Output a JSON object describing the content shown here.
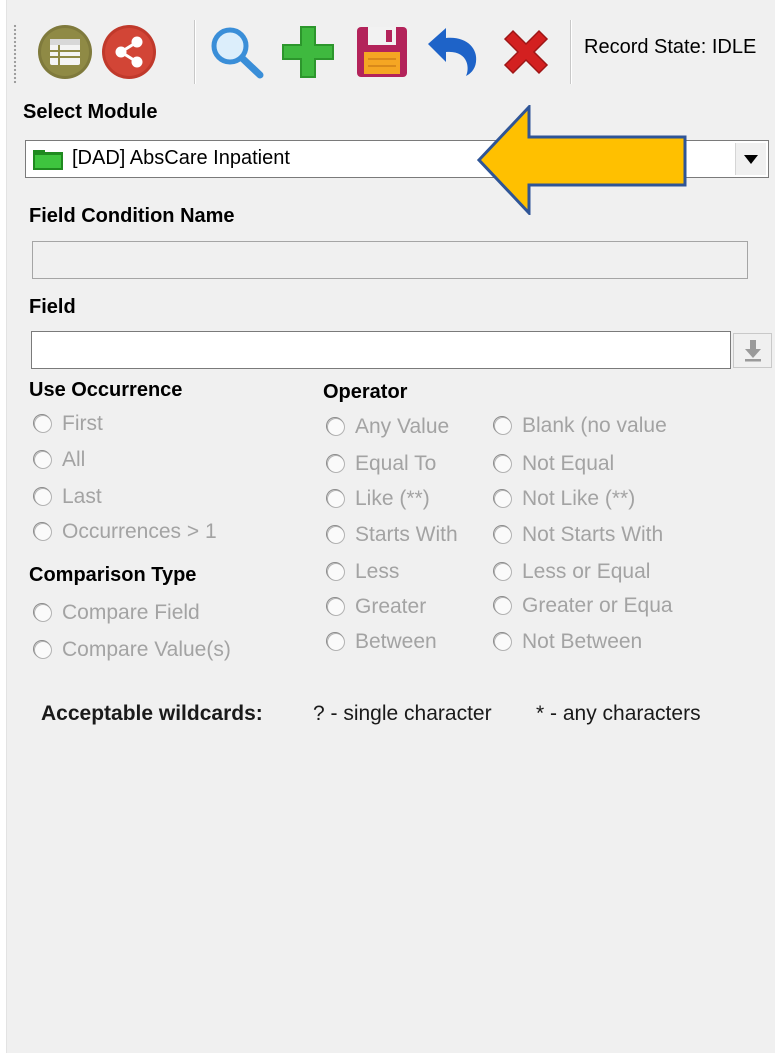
{
  "toolbar": {
    "buttons": [
      {
        "icon": "list-icon",
        "color": "#7d7a3e"
      },
      {
        "icon": "share-icon",
        "color": "#c0392b"
      },
      {
        "icon": "search-icon",
        "color": "#3a8ed8"
      },
      {
        "icon": "add-icon",
        "color": "#3bb63b"
      },
      {
        "icon": "save-icon",
        "color": "#b0225a"
      },
      {
        "icon": "undo-icon",
        "color": "#1e63c8"
      },
      {
        "icon": "delete-icon",
        "color": "#d32020"
      }
    ],
    "record_state": "Record State: IDLE"
  },
  "select_module": {
    "label": "Select Module",
    "value": "[DAD] AbsCare Inpatient"
  },
  "field_condition_name": {
    "label": "Field Condition Name",
    "value": ""
  },
  "field": {
    "label": "Field",
    "value": ""
  },
  "use_occurrence": {
    "label": "Use Occurrence",
    "options": [
      "First",
      "All",
      "Last",
      "Occurrences > 1"
    ]
  },
  "comparison_type": {
    "label": "Comparison Type",
    "options": [
      "Compare Field",
      "Compare Value(s)"
    ]
  },
  "operator": {
    "label": "Operator",
    "left": [
      "Any Value",
      "Equal To",
      "Like (**)",
      "Starts With",
      "Less",
      "Greater",
      "Between"
    ],
    "right": [
      "Blank (no value",
      "Not Equal",
      "Not Like (**)",
      "Not Starts With",
      "Less or Equal",
      "Greater or Equa",
      "Not Between"
    ]
  },
  "wildcards": {
    "label": "Acceptable wildcards:",
    "single": "? -  single character",
    "any": "* - any characters"
  },
  "colors": {
    "arrow": "#ffc000",
    "arrow_border": "#2f5597",
    "disabled_text": "#a3a3a3"
  }
}
